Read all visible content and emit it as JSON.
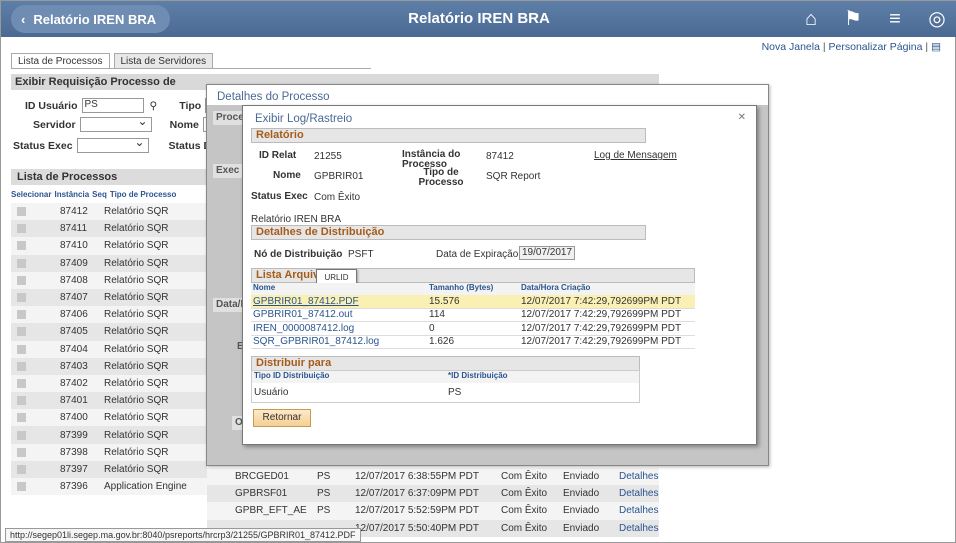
{
  "header": {
    "back_label": "Relatório IREN BRA",
    "title": "Relatório IREN BRA",
    "icons": [
      "home-icon",
      "flag-icon",
      "menu-icon",
      "compass-icon"
    ]
  },
  "toplinks": {
    "new_window": "Nova Janela",
    "personalize": "Personalizar Página"
  },
  "tabs": [
    "Lista de Processos",
    "Lista de Servidores"
  ],
  "filter": {
    "section_title": "Exibir Requisição Processo de",
    "user_id_label": "ID Usuário",
    "user_id_value": "PS",
    "type_label": "Tipo",
    "server_label": "Servidor",
    "name_label": "Nome",
    "exec_status_label": "Status Exec",
    "status_label": "Status Di"
  },
  "process_list": {
    "title": "Lista de Processos",
    "columns": [
      "Selecionar",
      "Instância",
      "Seq",
      "Tipo de Processo"
    ],
    "rows": [
      {
        "inst": "87412",
        "type": "Relatório SQR"
      },
      {
        "inst": "87411",
        "type": "Relatório SQR"
      },
      {
        "inst": "87410",
        "type": "Relatório SQR"
      },
      {
        "inst": "87409",
        "type": "Relatório SQR"
      },
      {
        "inst": "87408",
        "type": "Relatório SQR"
      },
      {
        "inst": "87407",
        "type": "Relatório SQR"
      },
      {
        "inst": "87406",
        "type": "Relatório SQR"
      },
      {
        "inst": "87405",
        "type": "Relatório SQR"
      },
      {
        "inst": "87404",
        "type": "Relatório SQR"
      },
      {
        "inst": "87403",
        "type": "Relatório SQR"
      },
      {
        "inst": "87402",
        "type": "Relatório SQR"
      },
      {
        "inst": "87401",
        "type": "Relatório SQR"
      },
      {
        "inst": "87400",
        "type": "Relatório SQR"
      },
      {
        "inst": "87399",
        "type": "Relatório SQR"
      },
      {
        "inst": "87398",
        "type": "Relatório SQR"
      },
      {
        "inst": "87397",
        "type": "Relatório SQR"
      },
      {
        "inst": "87396",
        "type": "Application Engine"
      }
    ],
    "extra_rows": [
      {
        "name": "BRCGED01",
        "user": "PS",
        "date": "12/07/2017  6:38:55PM PDT",
        "run": "Com Êxito",
        "dist": "Enviado",
        "link": "Detalhes"
      },
      {
        "name": "GPBRSF01",
        "user": "PS",
        "date": "12/07/2017  6:37:09PM PDT",
        "run": "Com Êxito",
        "dist": "Enviado",
        "link": "Detalhes"
      },
      {
        "name": "GPBR_EFT_AE",
        "user": "PS",
        "date": "12/07/2017  5:52:59PM PDT",
        "run": "Com Êxito",
        "dist": "Enviado",
        "link": "Detalhes"
      },
      {
        "name": "",
        "user": "",
        "date": "12/07/2017  5:50:40PM PDT",
        "run": "Com Êxito",
        "dist": "Enviado",
        "link": "Detalhes"
      }
    ]
  },
  "status_url": "http://segep01li.segep.ma.gov.br:8040/psreports/hrcrp3/21255/GPBRIR01_87412.PDF",
  "outer_modal": {
    "title": "Detalhes do Processo",
    "label_proc": "Proce",
    "label_exec": "Exec",
    "label_data": "Data/H",
    "label_e": "E",
    "label_ok": "Ok"
  },
  "inner_modal": {
    "title": "Exibir Log/Rastreio",
    "close": "✕",
    "report_bar": "Relatório",
    "report_id_label": "ID Relat",
    "report_id": "21255",
    "instance_label": "Instância do Processo",
    "instance": "87412",
    "msg_log_link": "Log de Mensagem",
    "name_label": "Nome",
    "name": "GPBRIR01",
    "proc_type_label": "Tipo de Processo",
    "proc_type": "SQR Report",
    "exec_status_label": "Status Exec",
    "exec_status": "Com Êxito",
    "report_desc": "Relatório IREN BRA",
    "dist_bar": "Detalhes de Distribuição",
    "dist_node_label": "Nó de Distribuição",
    "dist_node": "PSFT",
    "exp_date_label": "Data de Expiração",
    "exp_date": "19/07/2017",
    "files_bar": "Lista Arquivos",
    "tooltip": "URLID",
    "file_columns": [
      "Nome",
      "Tamanho (Bytes)",
      "Data/Hora Criação"
    ],
    "files": [
      {
        "name": "GPBRIR01_87412.PDF",
        "size": "15.576",
        "date": "12/07/2017  7:42:29,792699PM PDT"
      },
      {
        "name": "GPBRIR01_87412.out",
        "size": "114",
        "date": "12/07/2017  7:42:29,792699PM PDT"
      },
      {
        "name": "IREN_0000087412.log",
        "size": "0",
        "date": "12/07/2017  7:42:29,792699PM PDT"
      },
      {
        "name": "SQR_GPBRIR01_87412.log",
        "size": "1.626",
        "date": "12/07/2017  7:42:29,792699PM PDT"
      }
    ],
    "distribute_bar": "Distribuir para",
    "dist_columns": [
      "Tipo ID Distribuição",
      "*ID Distribuição"
    ],
    "dist_rows": [
      {
        "type": "Usuário",
        "id": "PS"
      }
    ],
    "return_button": "Retornar"
  },
  "colors": {
    "header": "#4a6a94",
    "section_text": "#a65c1a",
    "link": "#2a5590",
    "selected_row": "#fbf0b3"
  }
}
